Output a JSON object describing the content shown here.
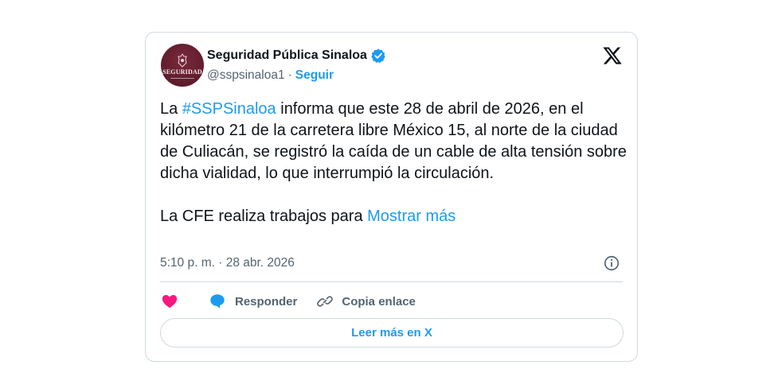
{
  "tweet": {
    "author": {
      "name": "Seguridad Pública Sinaloa",
      "handle": "@sspsinaloa1",
      "follow_label": "Seguir",
      "avatar_text": "SEGURIDAD",
      "verified": true
    },
    "text": {
      "p1_before": "La ",
      "hashtag": "#SSPSinaloa",
      "p1_after": " informa que este 28 de abril de 2026, en el kilómetro 21 de la carretera libre México 15, al norte de la ciudad de Culiacán, se registró la caída de un cable de alta tensión sobre dicha vialidad, lo que interrumpió la circulación.",
      "p2": "La CFE realiza trabajos para ",
      "show_more": "Mostrar más"
    },
    "timestamp": "5:10 p. m. · 28 abr. 2026",
    "actions": {
      "reply_label": "Responder",
      "copy_link_label": "Copia enlace"
    },
    "read_more_label": "Leer más en X"
  },
  "colors": {
    "accent": "#1d9bf0",
    "heart": "#f91880",
    "muted": "#536471",
    "border": "#cfd9de",
    "avatar": "#5e1c2c"
  },
  "icons": [
    "verified-badge-icon",
    "x-logo-icon",
    "info-icon",
    "heart-icon",
    "reply-bubble-icon",
    "link-icon"
  ]
}
